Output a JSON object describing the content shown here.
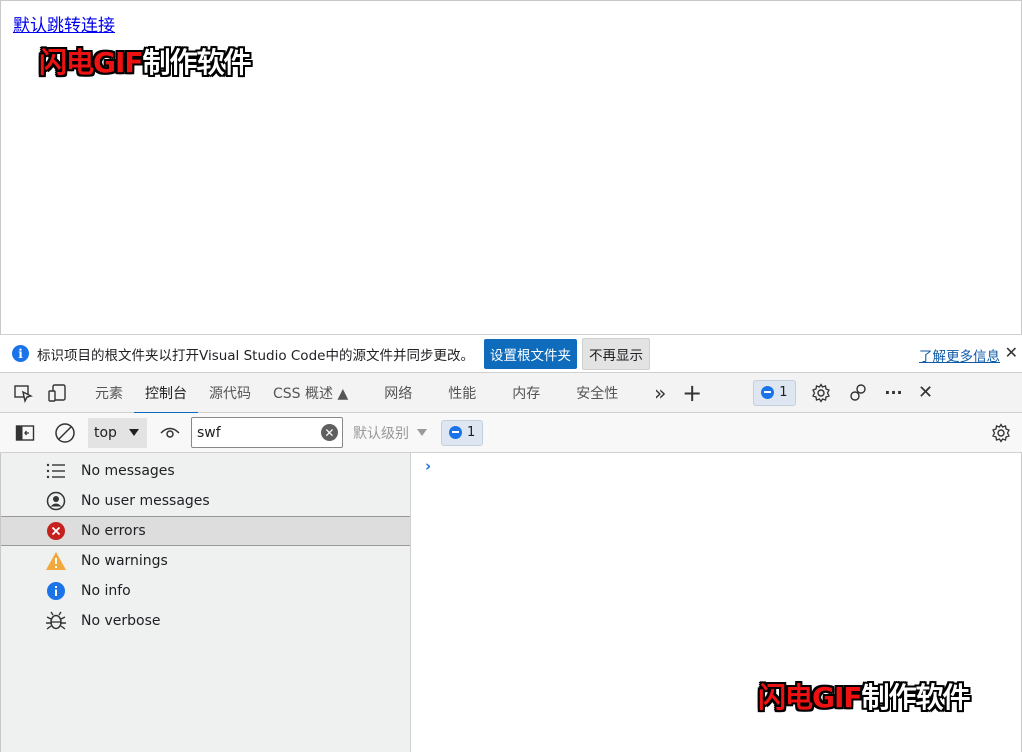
{
  "page": {
    "link_text": "默认跳转连接",
    "watermark_red": "闪电GIF",
    "watermark_white": "制作软件"
  },
  "infobar": {
    "text": "标识项目的根文件夹以打开Visual Studio Code中的源文件并同步更改。",
    "primary_button": "设置根文件夹",
    "secondary_button": "不再显示",
    "learn_more": "了解更多信息",
    "close": "✕"
  },
  "tabs": [
    {
      "label": "元素"
    },
    {
      "label": "控制台"
    },
    {
      "label": "源代码"
    },
    {
      "label": "CSS 概述 ▲"
    },
    {
      "label": "网络"
    },
    {
      "label": "性能"
    },
    {
      "label": "内存"
    },
    {
      "label": "安全性"
    }
  ],
  "toolbar": {
    "more": "»",
    "add": "+",
    "issues_count": "1",
    "dots": "···",
    "close": "✕"
  },
  "console_bar": {
    "context": "top",
    "filter_value": "swf",
    "level": "默认级别",
    "issues_count": "1"
  },
  "sidebar": {
    "items": [
      {
        "label": "No messages",
        "icon": "list-icon"
      },
      {
        "label": "No user messages",
        "icon": "user-icon"
      },
      {
        "label": "No errors",
        "icon": "error-icon"
      },
      {
        "label": "No warnings",
        "icon": "warning-icon"
      },
      {
        "label": "No info",
        "icon": "info-icon"
      },
      {
        "label": "No verbose",
        "icon": "bug-icon"
      }
    ]
  },
  "console": {
    "prompt": "›"
  },
  "colors": {
    "accent": "#0f6cbd",
    "error": "#c5221f",
    "warning": "#f2a93b",
    "info": "#1a73e8"
  }
}
